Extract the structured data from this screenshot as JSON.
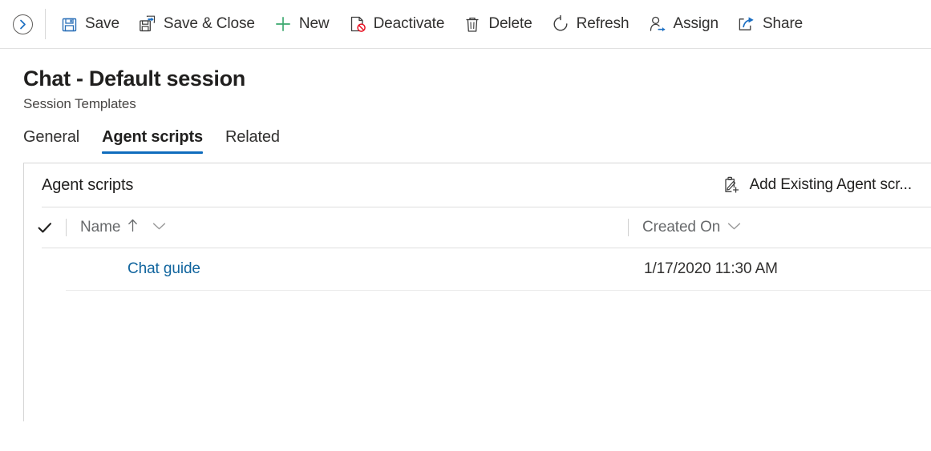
{
  "command_bar": {
    "back_button": {
      "name": "back-arrow",
      "label": ""
    },
    "items": [
      {
        "label": "Save",
        "icon": "save-icon"
      },
      {
        "label": "Save & Close",
        "icon": "save-and-close-icon"
      },
      {
        "label": "New",
        "icon": "plus-icon"
      },
      {
        "label": "Deactivate",
        "icon": "deactivate-icon"
      },
      {
        "label": "Delete",
        "icon": "trash-icon"
      },
      {
        "label": "Refresh",
        "icon": "refresh-icon"
      },
      {
        "label": "Assign",
        "icon": "assign-person-icon"
      },
      {
        "label": "Share",
        "icon": "share-icon"
      }
    ]
  },
  "header": {
    "title": "Chat - Default session",
    "subtitle": "Session Templates"
  },
  "tabs": [
    {
      "label": "General",
      "active": false
    },
    {
      "label": "Agent scripts",
      "active": true
    },
    {
      "label": "Related",
      "active": false
    }
  ],
  "subgrid": {
    "title": "Agent scripts",
    "action": {
      "label": "Add Existing Agent scr...",
      "icon": "add-existing-record-icon"
    },
    "columns": [
      {
        "label": "Name",
        "sort": "ascending",
        "sort_icon": "arrow-up-icon",
        "menu_icon": "chevron-down-icon"
      },
      {
        "label": "Created On",
        "sort": "none",
        "menu_icon": "chevron-down-icon"
      }
    ],
    "select_all_icon": "checkmark-icon",
    "rows": [
      {
        "name": "Chat guide",
        "created_on": "1/17/2020 11:30 AM"
      }
    ]
  },
  "colors": {
    "accent": "#0f6cbd",
    "link": "#11659e",
    "save_icon": "#2b70b8",
    "new_icon": "#3aa76d",
    "danger": "#e81123",
    "text": "#323130",
    "muted": "#67696b",
    "border": "#d6d6d6"
  }
}
